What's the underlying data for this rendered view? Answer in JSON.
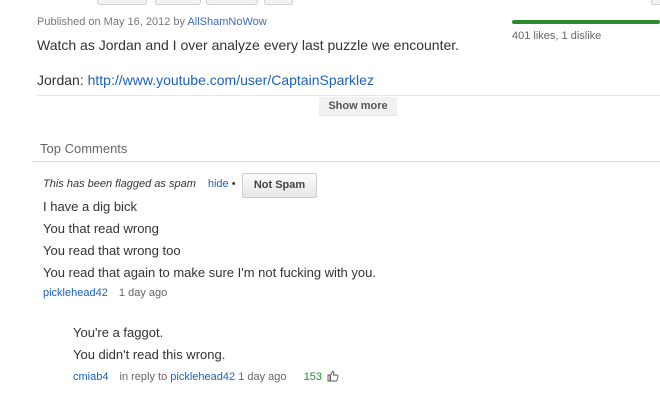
{
  "video": {
    "published_prefix": "Published on May 16, 2012 by",
    "author": "AllShamNoWow",
    "description_line1": "Watch as Jordan and I over analyze every last puzzle we encounter.",
    "description_line2_label": "Jordan:",
    "description_line2_link": "http://www.youtube.com/user/CaptainSparklez",
    "show_more": "Show more",
    "likes_text": "401 likes, 1 dislike",
    "like_bar_color": "#2b8a2b"
  },
  "comments": {
    "section_title": "Top Comments",
    "flagged": {
      "notice": "This has been flagged as spam",
      "hide": "hide",
      "separator": "•",
      "not_spam_button": "Not Spam",
      "lines": [
        "I have a dig bick",
        "You that read wrong",
        "You read that wrong too",
        "You read that again to make sure I'm not fucking with you."
      ],
      "author": "picklehead42",
      "time": "1 day ago"
    },
    "reply": {
      "lines": [
        "You're a faggot.",
        "You didn't read this wrong."
      ],
      "author": "cmiab4",
      "in_reply_to_label": "in reply to",
      "in_reply_to_user": "picklehead42",
      "time": "1 day ago",
      "votes": "153",
      "thumb_icon": "thumbs-up-icon"
    }
  }
}
